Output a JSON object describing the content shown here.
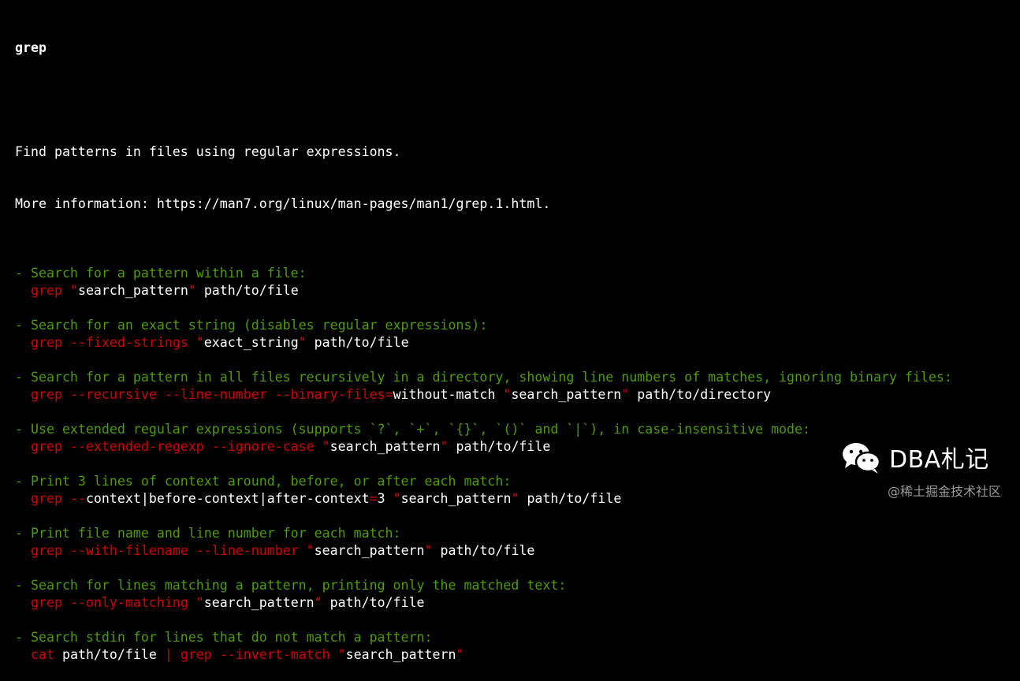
{
  "page": {
    "title": "grep",
    "description": "Find patterns in files using regular expressions.",
    "more_info": "More information: https://man7.org/linux/man-pages/man1/grep.1.html."
  },
  "colors": {
    "background": "#000000",
    "description": "#4e9a06",
    "command": "#cc0000",
    "argument": "#ffffff"
  },
  "examples": [
    {
      "description": "- Search for a pattern within a file:",
      "tokens": [
        {
          "text": "grep ",
          "color": "red"
        },
        {
          "text": "\"",
          "color": "red"
        },
        {
          "text": "search_pattern",
          "color": "white"
        },
        {
          "text": "\"",
          "color": "red"
        },
        {
          "text": " path/to/file",
          "color": "white"
        }
      ]
    },
    {
      "description": "- Search for an exact string (disables regular expressions):",
      "tokens": [
        {
          "text": "grep --fixed-strings ",
          "color": "red"
        },
        {
          "text": "\"",
          "color": "red"
        },
        {
          "text": "exact_string",
          "color": "white"
        },
        {
          "text": "\"",
          "color": "red"
        },
        {
          "text": " path/to/file",
          "color": "white"
        }
      ]
    },
    {
      "description": "- Search for a pattern in all files recursively in a directory, showing line numbers of matches, ignoring binary files:",
      "tokens": [
        {
          "text": "grep --recursive --line-number --binary-files=",
          "color": "red"
        },
        {
          "text": "without-match ",
          "color": "white"
        },
        {
          "text": "\"",
          "color": "red"
        },
        {
          "text": "search_pattern",
          "color": "white"
        },
        {
          "text": "\"",
          "color": "red"
        },
        {
          "text": " path/to/directory",
          "color": "white"
        }
      ]
    },
    {
      "description": "- Use extended regular expressions (supports `?`, `+`, `{}`, `()` and `|`), in case-insensitive mode:",
      "tokens": [
        {
          "text": "grep --extended-regexp --ignore-case ",
          "color": "red"
        },
        {
          "text": "\"",
          "color": "red"
        },
        {
          "text": "search_pattern",
          "color": "white"
        },
        {
          "text": "\"",
          "color": "red"
        },
        {
          "text": " path/to/file",
          "color": "white"
        }
      ]
    },
    {
      "description": "- Print 3 lines of context around, before, or after each match:",
      "tokens": [
        {
          "text": "grep --",
          "color": "red"
        },
        {
          "text": "context|before-context|after-context",
          "color": "white"
        },
        {
          "text": "=",
          "color": "red"
        },
        {
          "text": "3 ",
          "color": "white"
        },
        {
          "text": "\"",
          "color": "red"
        },
        {
          "text": "search_pattern",
          "color": "white"
        },
        {
          "text": "\"",
          "color": "red"
        },
        {
          "text": " path/to/file",
          "color": "white"
        }
      ]
    },
    {
      "description": "- Print file name and line number for each match:",
      "tokens": [
        {
          "text": "grep --with-filename --line-number ",
          "color": "red"
        },
        {
          "text": "\"",
          "color": "red"
        },
        {
          "text": "search_pattern",
          "color": "white"
        },
        {
          "text": "\"",
          "color": "red"
        },
        {
          "text": " path/to/file",
          "color": "white"
        }
      ]
    },
    {
      "description": "- Search for lines matching a pattern, printing only the matched text:",
      "tokens": [
        {
          "text": "grep --only-matching ",
          "color": "red"
        },
        {
          "text": "\"",
          "color": "red"
        },
        {
          "text": "search_pattern",
          "color": "white"
        },
        {
          "text": "\"",
          "color": "red"
        },
        {
          "text": " path/to/file",
          "color": "white"
        }
      ]
    },
    {
      "description": "- Search stdin for lines that do not match a pattern:",
      "tokens": [
        {
          "text": "cat ",
          "color": "red"
        },
        {
          "text": "path/to/file ",
          "color": "white"
        },
        {
          "text": "| grep --invert-match ",
          "color": "red"
        },
        {
          "text": "\"",
          "color": "red"
        },
        {
          "text": "search_pattern",
          "color": "white"
        },
        {
          "text": "\"",
          "color": "red"
        }
      ]
    }
  ],
  "watermark": {
    "icon": "wechat-icon",
    "label": "DBA札记",
    "sub": "@稀土掘金技术社区"
  }
}
